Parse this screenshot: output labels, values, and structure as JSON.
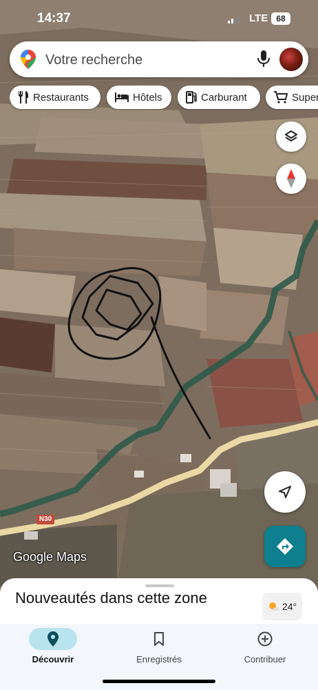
{
  "status_bar": {
    "time": "14:37",
    "network": "LTE",
    "battery": "68"
  },
  "search": {
    "placeholder": "Votre recherche"
  },
  "chips": [
    {
      "label": "Restaurants",
      "icon": "fork-knife-icon"
    },
    {
      "label": "Hôtels",
      "icon": "bed-icon"
    },
    {
      "label": "Carburant",
      "icon": "fuel-pump-icon"
    },
    {
      "label": "Super",
      "icon": "shopping-cart-icon"
    }
  ],
  "map": {
    "attribution": "Google Maps",
    "road_label": "N30",
    "colors": {
      "road": "#ead9a4",
      "river": "#2f5a4a",
      "fields": "#8a7665",
      "drawing": "#111111"
    }
  },
  "map_controls": {
    "layers": "layers-icon",
    "compass": "compass-icon",
    "my_location": "location-arrow-icon",
    "directions": "directions-icon",
    "directions_color": "#0e7f8e"
  },
  "sheet": {
    "title": "Nouveautés dans cette zone",
    "weather_temp": "24°",
    "weather_icon": "partly-sunny-icon"
  },
  "bottom_nav": [
    {
      "label": "Découvrir",
      "icon": "location-pin-icon",
      "active": true
    },
    {
      "label": "Enregistrés",
      "icon": "bookmark-icon",
      "active": false
    },
    {
      "label": "Contribuer",
      "icon": "plus-circle-icon",
      "active": false
    }
  ]
}
